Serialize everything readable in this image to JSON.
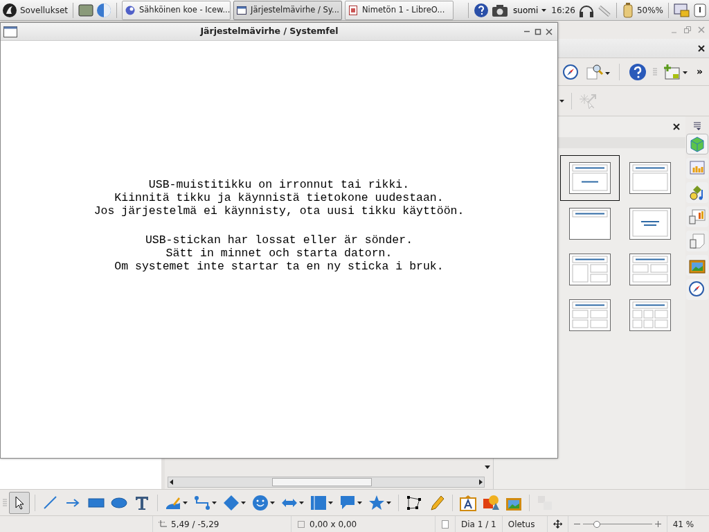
{
  "taskbar": {
    "start_label": "Sovellukset",
    "tasks": [
      {
        "label": "Sähköinen koe - Icew...",
        "selected": false
      },
      {
        "label": "Järjestelmävirhe / Sy...",
        "selected": true
      },
      {
        "label": "Nimetön 1 - LibreO...",
        "selected": false
      }
    ],
    "keyboard": "suomi",
    "clock": "16:26",
    "battery": "50%%"
  },
  "dialog": {
    "title": "Järjestelmävirhe / Systemfel",
    "paragraphs": [
      [
        "USB-muistitikku on irronnut tai rikki.",
        "Kiinnitä tikku ja käynnistä tietokone uudestaan.",
        "Jos järjestelmä ei käynnisty, ota uusi tikku käyttöön."
      ],
      [
        "USB-stickan har lossat eller är sönder.",
        "Sätt in minnet och starta datorn.",
        "Om systemet inte startar ta en ny sticka i bruk."
      ]
    ]
  },
  "toolbar": {
    "overflow": "»"
  },
  "layouts": [
    {
      "kind": "title-slide",
      "selected": true
    },
    {
      "kind": "title-content",
      "selected": false
    },
    {
      "kind": "title-only",
      "selected": false
    },
    {
      "kind": "centered-text",
      "selected": false
    },
    {
      "kind": "title-content-2",
      "selected": false
    },
    {
      "kind": "title-2-content",
      "selected": false
    },
    {
      "kind": "title-4",
      "selected": false
    },
    {
      "kind": "title-6",
      "selected": false
    }
  ],
  "sidebar_tabs": [
    {
      "selected": true
    },
    {
      "selected": false
    },
    {
      "selected": false
    },
    {
      "selected": false
    },
    {
      "selected": false
    },
    {
      "selected": false
    },
    {
      "selected": false
    }
  ],
  "draw_tools": [
    {
      "selected": true,
      "dropdown": false,
      "disabled": false
    },
    {
      "selected": false,
      "dropdown": false,
      "disabled": false
    },
    {
      "selected": false,
      "dropdown": false,
      "disabled": false
    },
    {
      "selected": false,
      "dropdown": false,
      "disabled": false
    },
    {
      "selected": false,
      "dropdown": false,
      "disabled": false
    },
    {
      "selected": false,
      "dropdown": false,
      "disabled": false
    },
    {
      "selected": false,
      "dropdown": true,
      "disabled": false
    },
    {
      "selected": false,
      "dropdown": true,
      "disabled": false
    },
    {
      "selected": false,
      "dropdown": true,
      "disabled": false
    },
    {
      "selected": false,
      "dropdown": true,
      "disabled": false
    },
    {
      "selected": false,
      "dropdown": true,
      "disabled": false
    },
    {
      "selected": false,
      "dropdown": true,
      "disabled": false
    },
    {
      "selected": false,
      "dropdown": true,
      "disabled": false
    },
    {
      "selected": false,
      "dropdown": true,
      "disabled": false
    },
    {
      "selected": false,
      "dropdown": false,
      "disabled": false
    },
    {
      "selected": false,
      "dropdown": false,
      "disabled": false
    },
    {
      "selected": false,
      "dropdown": false,
      "disabled": false
    },
    {
      "selected": false,
      "dropdown": false,
      "disabled": false
    },
    {
      "selected": false,
      "dropdown": false,
      "disabled": false
    },
    {
      "selected": false,
      "dropdown": false,
      "disabled": true
    }
  ],
  "status_bar": {
    "position": "5,49 / -5,29",
    "size": "0,00 x 0,00",
    "slide": "Dia 1 / 1",
    "master": "Oletus",
    "zoom_slider": {
      "level": 0.2
    },
    "zoom": "41 %"
  }
}
